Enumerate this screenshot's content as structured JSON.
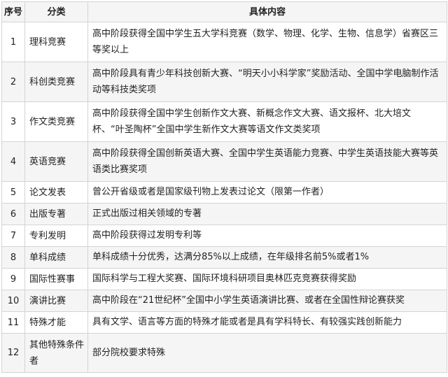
{
  "header": {
    "col_no": "序号",
    "col_category": "分类",
    "col_content": "具体内容"
  },
  "rows": [
    {
      "no": "1",
      "category": "理科竞赛",
      "content": "高中阶段获得全国中学生五大学科竞赛（数学、物理、化学、生物、信息学）省赛区三等奖以上"
    },
    {
      "no": "2",
      "category": "科创类竞赛",
      "content": "高中阶段具有青少年科技创新大赛、“明天小小科学家”奖励活动、全国中学电脑制作活动等科技类奖项"
    },
    {
      "no": "3",
      "category": "作文类竞赛",
      "content": "高中阶段获得全国中学生创新作文大赛、新概念作文大赛、语文报杯、北大培文杯、“叶圣陶杯”全国中学生新作文大赛等语文作文类奖项"
    },
    {
      "no": "4",
      "category": "英语竞赛",
      "content": "高中阶段获得全国创新英语大赛、全国中学生英语能力竞赛、中学生英语技能大赛等英语类比赛奖项"
    },
    {
      "no": "5",
      "category": "论文发表",
      "content": "曾公开省级或者是国家级刊物上发表过论文（限第一作者）"
    },
    {
      "no": "6",
      "category": "出版专著",
      "content": "正式出版过相关领域的专著"
    },
    {
      "no": "7",
      "category": "专利发明",
      "content": "高中阶段获得过发明专利等"
    },
    {
      "no": "8",
      "category": "单科成绩",
      "content": "单科成绩十分优秀，达满分85%以上成绩，在年级排名前5%或者1%"
    },
    {
      "no": "9",
      "category": "国际性赛事",
      "content": "国际科学与工程大奖赛、国际环境科研项目奥林匹克竞赛获得奖励"
    },
    {
      "no": "10",
      "category": "演讲比赛",
      "content": "高中阶段在“21世纪杯”全国中小学生英语演讲比赛、或者在全国性辩论赛获奖"
    },
    {
      "no": "11",
      "category": "特殊才能",
      "content": "具有文学、语言等方面的特殊才能或者是具有学科特长、有较强实践创新能力"
    },
    {
      "no": "12",
      "category": "其他特殊条件者",
      "content": "部分院校要求特殊"
    }
  ]
}
